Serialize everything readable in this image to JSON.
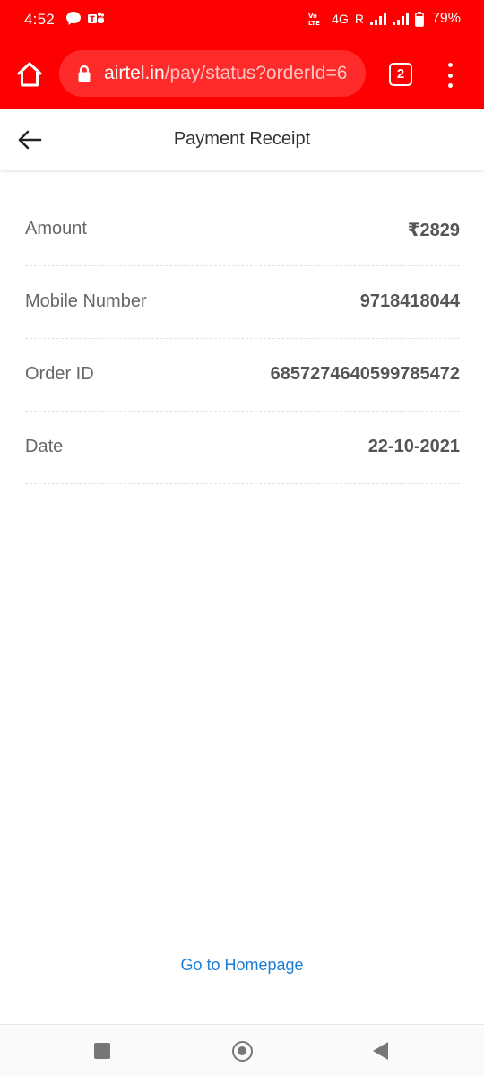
{
  "status_bar": {
    "time": "4:52",
    "network_label": "4G",
    "roaming_label": "R",
    "battery_percent": "79%",
    "volte_label": "Vo))\nLTE1"
  },
  "browser": {
    "url_host": "airtel.in",
    "url_path": "/pay/status?orderId=6",
    "tab_count": "2"
  },
  "header": {
    "title": "Payment Receipt"
  },
  "receipt": {
    "rows": [
      {
        "label": "Amount",
        "value": "₹2829"
      },
      {
        "label": "Mobile Number",
        "value": "9718418044"
      },
      {
        "label": "Order ID",
        "value": "6857274640599785472"
      },
      {
        "label": "Date",
        "value": "22-10-2021"
      }
    ]
  },
  "footer": {
    "home_link": "Go to Homepage"
  },
  "colors": {
    "brand_red": "#ff0000",
    "link_blue": "#1f7ed6"
  },
  "icons": {
    "home": "home-icon",
    "lock": "lock-icon",
    "tabs": "tabs-icon",
    "menu": "more-vert-icon",
    "back": "arrow-left-icon"
  }
}
